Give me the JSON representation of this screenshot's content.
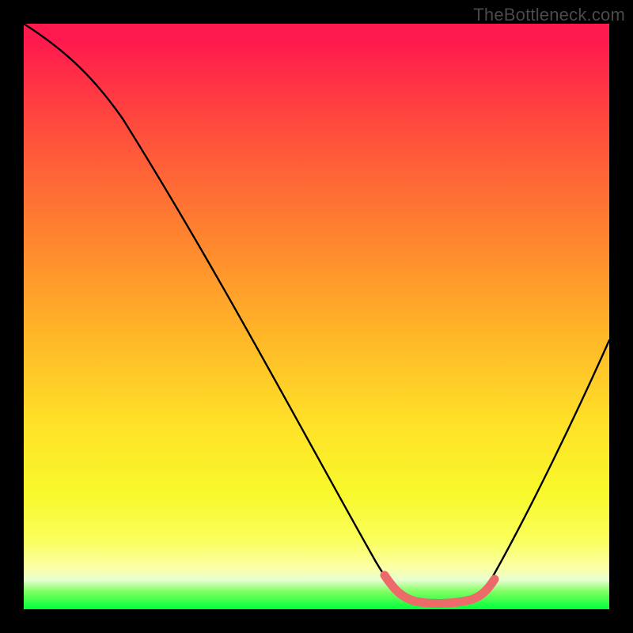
{
  "watermark": "TheBottleneck.com",
  "colors": {
    "background": "#000000",
    "curve": "#000000",
    "flat_segment": "#ed6a6a",
    "gradient_top": "#ff1a4d",
    "gradient_bottom": "#00ff3c"
  },
  "chart_data": {
    "type": "line",
    "title": "",
    "xlabel": "",
    "ylabel": "",
    "xlim": [
      0,
      100
    ],
    "ylim": [
      0,
      100
    ],
    "x": [
      0,
      5,
      10,
      15,
      20,
      25,
      30,
      35,
      40,
      45,
      50,
      55,
      60,
      62,
      66,
      70,
      74,
      78,
      80,
      85,
      90,
      95,
      100
    ],
    "values": [
      100,
      97,
      93,
      87,
      81,
      73,
      65,
      57,
      49,
      41,
      33,
      24,
      15,
      8,
      2,
      1,
      1,
      2,
      6,
      15,
      27,
      40,
      55
    ],
    "flat_region_x": [
      62,
      80
    ],
    "note": "y=0 is the bottom (green) edge; values ≈ percent up from bottom. Curve reaches its minimum (~1%) around x≈70–74, flat highlighted segment spans roughly x≈62–80 near the bottom."
  }
}
